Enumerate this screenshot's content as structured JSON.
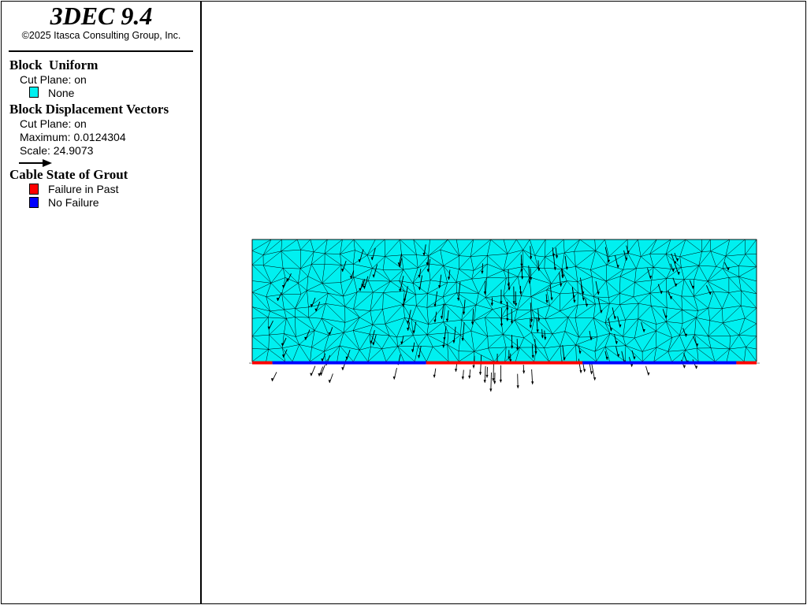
{
  "app": {
    "title": "3DEC 9.4",
    "copyright": "©2025 Itasca Consulting Group, Inc."
  },
  "legend": {
    "block_uniform": {
      "title": "Block  Uniform",
      "cut_plane": "Cut Plane: on",
      "entries": [
        {
          "label": "None",
          "color": "#00f0f0"
        }
      ]
    },
    "displacement": {
      "title": "Block Displacement Vectors",
      "cut_plane": "Cut Plane: on",
      "maximum": "Maximum: 0.0124304",
      "scale": "Scale: 24.9073",
      "arrow_icon": "right-arrow-icon"
    },
    "cable": {
      "title": "Cable State of Grout",
      "entries": [
        {
          "label": "Failure in Past",
          "color": "#ff0000"
        },
        {
          "label": "No Failure",
          "color": "#0000ff"
        }
      ]
    }
  },
  "model": {
    "fill_color": "#00f0f0",
    "mesh_color": "#000000",
    "vector_color": "#000000",
    "cable_states": [
      "Failure in Past",
      "No Failure",
      "Failure in Past",
      "No Failure",
      "Failure in Past"
    ],
    "cable_segments": [
      {
        "from": 0.0,
        "to": 0.04,
        "state": "Failure in Past"
      },
      {
        "from": 0.04,
        "to": 0.345,
        "state": "No Failure"
      },
      {
        "from": 0.345,
        "to": 0.655,
        "state": "Failure in Past"
      },
      {
        "from": 0.655,
        "to": 0.96,
        "state": "No Failure"
      },
      {
        "from": 0.96,
        "to": 1.0,
        "state": "Failure in Past"
      }
    ]
  }
}
